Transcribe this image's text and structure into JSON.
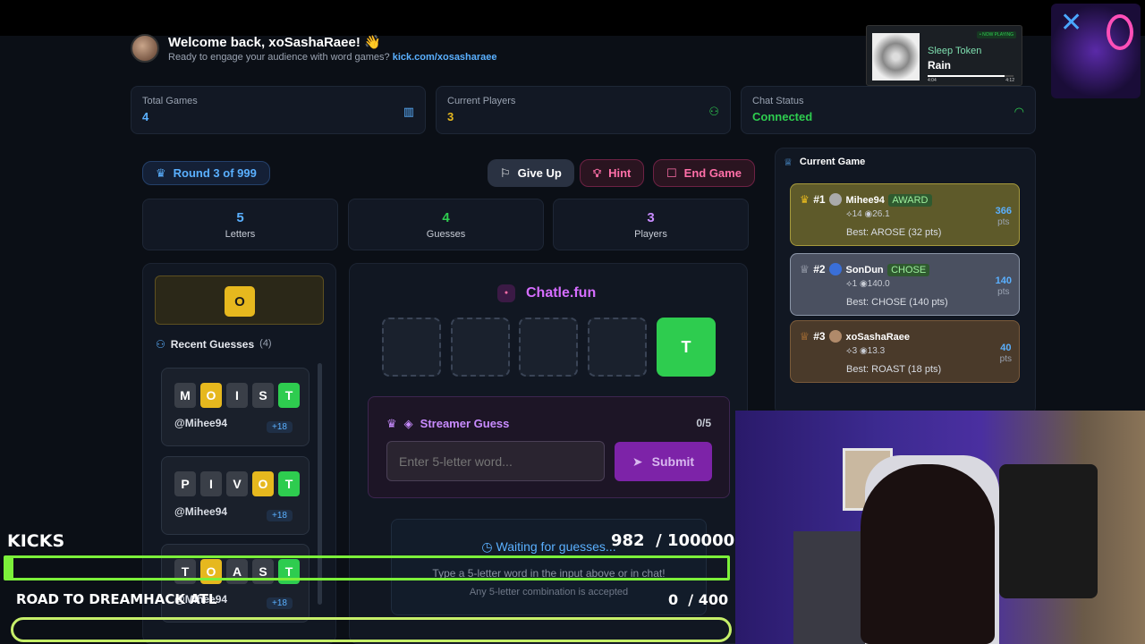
{
  "header": {
    "welcome": "Welcome back, xoSashaRaee! 👋",
    "subtitle": "Ready to engage your audience with word games?",
    "link": "kick.com/xosasharaee"
  },
  "stats": [
    {
      "label": "Total Games",
      "value": "4",
      "color": "#5ab0ff",
      "icon": "bar-chart-icon"
    },
    {
      "label": "Current Players",
      "value": "3",
      "color": "#e6b81e",
      "icon": "user-icon"
    },
    {
      "label": "Chat Status",
      "value": "Connected",
      "color": "#2ecc4f",
      "icon": "wifi-icon"
    }
  ],
  "controls": {
    "round": "Round 3 of 999",
    "give_up": "Give Up",
    "hint": "Hint",
    "end_game": "End Game"
  },
  "info": [
    {
      "num": "5",
      "label": "Letters",
      "color": "#5ab0ff"
    },
    {
      "num": "4",
      "label": "Guesses",
      "color": "#2ecc4f"
    },
    {
      "num": "3",
      "label": "Players",
      "color": "#c98cff"
    }
  ],
  "hint_letter": "O",
  "recent": {
    "title": "Recent Guesses",
    "count": "(4)",
    "items": [
      {
        "letters": [
          "M",
          "O",
          "I",
          "S",
          "T"
        ],
        "states": [
          "",
          "y",
          "",
          "",
          "g"
        ],
        "user": "@Mihee94",
        "pts": "+18"
      },
      {
        "letters": [
          "P",
          "I",
          "V",
          "O",
          "T"
        ],
        "states": [
          "",
          "",
          "",
          "y",
          "g"
        ],
        "user": "@Mihee94",
        "pts": "+18"
      },
      {
        "letters": [
          "T",
          "O",
          "A",
          "S",
          "T"
        ],
        "states": [
          "",
          "y",
          "",
          "",
          "g"
        ],
        "user": "@Mihee94",
        "pts": "+18"
      }
    ]
  },
  "board": {
    "brand": "Chatle.fun",
    "revealed": "T",
    "streamer_guess": "Streamer Guess",
    "guess_count": "0/5",
    "placeholder": "Enter 5-letter word...",
    "submit": "Submit",
    "waiting": "Waiting for guesses...",
    "waiting_sub": "Type a 5-letter word in the input above or in chat!",
    "waiting_sub2": "Any 5-letter combination is accepted"
  },
  "leaderboard": {
    "title": "Current Game",
    "entries": [
      {
        "rank": "#1",
        "name": "Mihee94",
        "tag": "AWARD",
        "meta": "⟡14 ◉26.1",
        "best": "Best: AROSE (32 pts)",
        "score": "366",
        "unit": "pts"
      },
      {
        "rank": "#2",
        "name": "SonDun",
        "tag": "CHOSE",
        "meta": "⟡1 ◉140.0",
        "best": "Best: CHOSE (140 pts)",
        "score": "140",
        "unit": "pts"
      },
      {
        "rank": "#3",
        "name": "xoSashaRaee",
        "tag": "",
        "meta": "⟡3 ◉13.3",
        "best": "Best: ROAST (18 pts)",
        "score": "40",
        "unit": "pts"
      }
    ]
  },
  "now_playing": {
    "badge": "• NOW PLAYING",
    "artist": "Sleep Token",
    "track": "Rain",
    "elapsed": "4:04",
    "total": "4:12",
    "progress": 0.9
  },
  "overlay": {
    "kicks": "KICKS",
    "kicks_count": "982",
    "kicks_goal": "/ 100000",
    "road": "ROAD TO DREAMHACK ATL",
    "road_count": "0",
    "road_goal": "/ 400"
  }
}
